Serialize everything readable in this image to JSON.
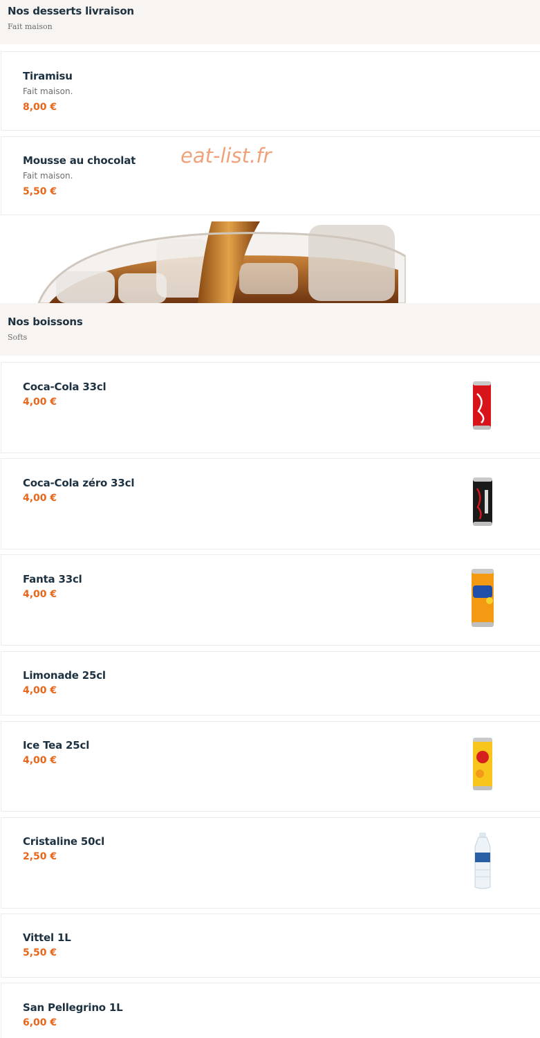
{
  "watermark": "eat-list.fr",
  "desserts": {
    "title": "Nos desserts livraison",
    "subtitle": "Fait maison",
    "items": [
      {
        "name": "Tiramisu",
        "description": "Fait maison.",
        "price": "8,00 €"
      },
      {
        "name": "Mousse au chocolat",
        "description": "Fait maison.",
        "price": "5,50 €"
      }
    ]
  },
  "drinks": {
    "title": "Nos boissons",
    "subtitle": "Softs",
    "items": [
      {
        "name": "Coca-Cola 33cl",
        "price": "4,00 €",
        "icon": "coca-cola-can-icon"
      },
      {
        "name": "Coca-Cola zéro 33cl",
        "price": "4,00 €",
        "icon": "coca-cola-zero-can-icon"
      },
      {
        "name": "Fanta 33cl",
        "price": "4,00 €",
        "icon": "fanta-can-icon"
      },
      {
        "name": "Limonade 25cl",
        "price": "4,00 €"
      },
      {
        "name": "Ice Tea 25cl",
        "price": "4,00 €",
        "icon": "lipton-can-icon"
      },
      {
        "name": "Cristaline 50cl",
        "price": "2,50 €",
        "icon": "water-bottle-icon"
      },
      {
        "name": "Vittel 1L",
        "price": "5,50 €"
      },
      {
        "name": "San Pellegrino 1L",
        "price": "6,00 €"
      }
    ]
  },
  "colors": {
    "accent_price": "#e8661b",
    "title_text": "#1d3140",
    "section_background": "#f7f4f1"
  }
}
